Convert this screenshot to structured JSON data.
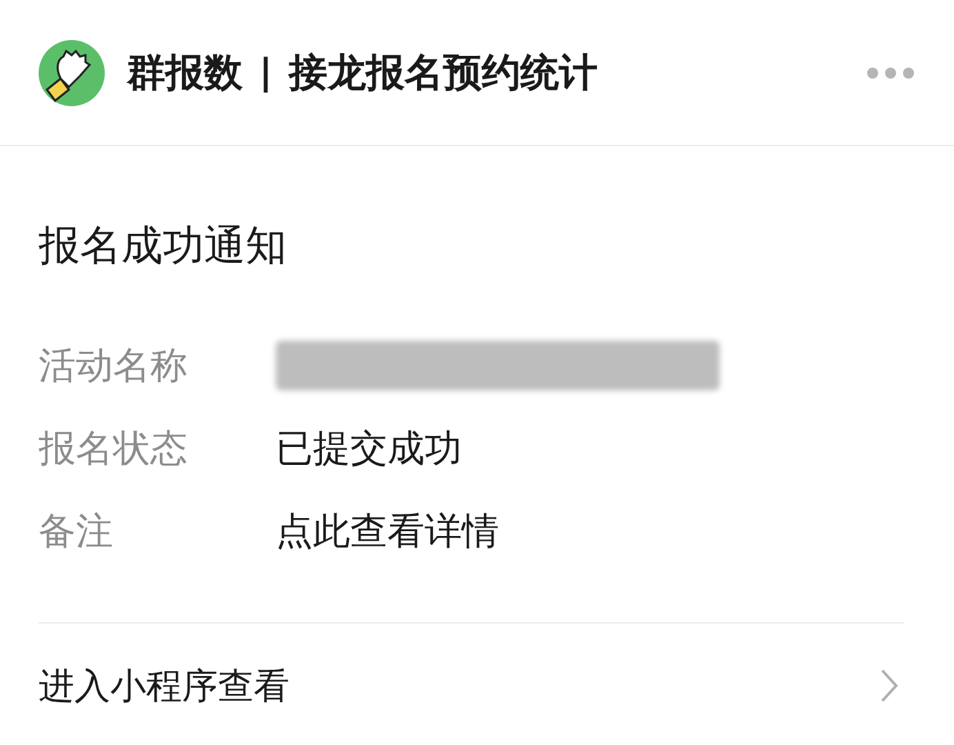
{
  "header": {
    "app_name": "群报数",
    "separator": "|",
    "subtitle": "接龙报名预约统计"
  },
  "card": {
    "title": "报名成功通知",
    "fields": [
      {
        "label": "活动名称",
        "kind": "redacted"
      },
      {
        "label": "报名状态",
        "kind": "text",
        "value": "已提交成功"
      },
      {
        "label": "备注",
        "kind": "text",
        "value": "点此查看详情"
      }
    ]
  },
  "footer": {
    "link": "进入小程序查看"
  }
}
